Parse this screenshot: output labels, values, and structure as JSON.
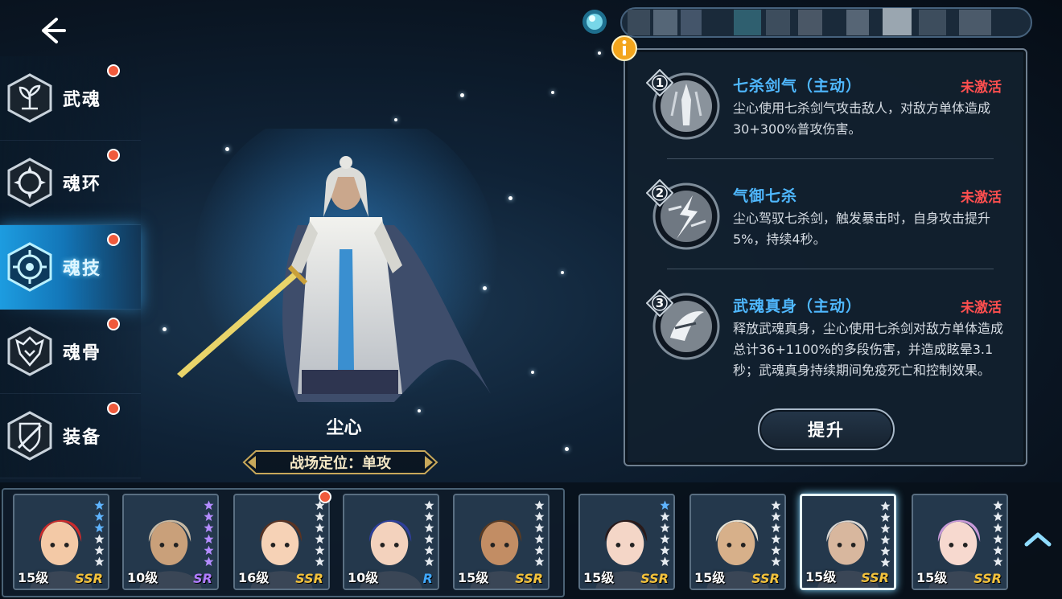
{
  "nav": {
    "items": [
      {
        "label": "武魂",
        "icon": "sprout-icon",
        "badge": true
      },
      {
        "label": "魂环",
        "icon": "ring-icon",
        "badge": true
      },
      {
        "label": "魂技",
        "icon": "target-icon",
        "badge": true,
        "active": true
      },
      {
        "label": "魂骨",
        "icon": "bone-crest-icon",
        "badge": true
      },
      {
        "label": "装备",
        "icon": "shield-icon",
        "badge": true
      }
    ]
  },
  "character": {
    "name": "尘心",
    "role": "战场定位：单攻"
  },
  "skills": [
    {
      "num": "1",
      "title": "七杀剑气（主动）",
      "status": "未激活",
      "desc": "尘心使用七杀剑气攻击敌人，对敌方单体造成30+300%普攻伤害。"
    },
    {
      "num": "2",
      "title": "气御七杀",
      "status": "未激活",
      "desc": "尘心驾驭七杀剑，触发暴击时，自身攻击提升5%，持续4秒。"
    },
    {
      "num": "3",
      "title": "武魂真身（主动）",
      "status": "未激活",
      "desc": "释放武魂真身，尘心使用七杀剑对敌方单体造成总计36+1100%的多段伤害，并造成眩晕3.1秒；武魂真身持续期间免疫死亡和控制效果。"
    }
  ],
  "upgrade_label": "提升",
  "roster": [
    {
      "level": "15级",
      "rarity": "SSR",
      "rarity_color": "#f2c23c",
      "hair": "#c92b2b",
      "skin": "#f3c9a6",
      "stars": 6,
      "filled": 3,
      "badge": false
    },
    {
      "level": "10级",
      "rarity": "SR",
      "rarity_color": "#b07cff",
      "hair": "#c7b9a4",
      "skin": "#c9a07a",
      "stars": 6,
      "filled": 6,
      "badge": false
    },
    {
      "level": "16级",
      "rarity": "SSR",
      "rarity_color": "#f2c23c",
      "hair": "#5a3322",
      "skin": "#f6d2b6",
      "stars": 6,
      "filled": 0,
      "badge": true
    },
    {
      "level": "10级",
      "rarity": "R",
      "rarity_color": "#3fa8ff",
      "hair": "#2e3f9a",
      "skin": "#f3d2bd",
      "stars": 6,
      "filled": 0,
      "badge": false
    },
    {
      "level": "15级",
      "rarity": "SSR",
      "rarity_color": "#f2c23c",
      "hair": "#5b3b22",
      "skin": "#c28d64",
      "stars": 6,
      "filled": 0,
      "badge": false
    },
    {
      "level": "15级",
      "rarity": "SSR",
      "rarity_color": "#f2c23c",
      "hair": "#2a1a1a",
      "skin": "#f4d6c7",
      "stars": 6,
      "filled": 1,
      "badge": false
    },
    {
      "level": "15级",
      "rarity": "SSR",
      "rarity_color": "#f2c23c",
      "hair": "#e8e2d4",
      "skin": "#d7b08a",
      "stars": 6,
      "filled": 0,
      "badge": false
    },
    {
      "level": "15级",
      "rarity": "SSR",
      "rarity_color": "#f2c23c",
      "hair": "#d9d6d2",
      "skin": "#d8b79e",
      "stars": 6,
      "filled": 0,
      "badge": false,
      "selected": true
    },
    {
      "level": "15级",
      "rarity": "SSR",
      "rarity_color": "#f2c23c",
      "hair": "#c89ad8",
      "skin": "#f7d9cf",
      "stars": 6,
      "filled": 0,
      "badge": false
    }
  ],
  "colors": {
    "accent": "#1d9ce0",
    "skill_title": "#4fb8ff",
    "inactive": "#ff4f4f"
  }
}
